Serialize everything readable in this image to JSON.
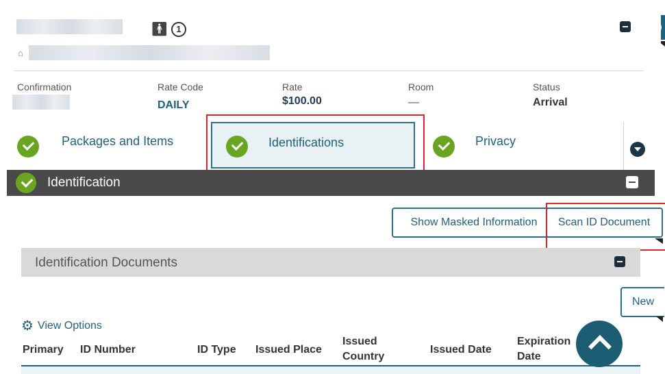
{
  "header": {
    "guest_count": "1",
    "info_icon": "info-circle-icon",
    "home_icon": "home-icon"
  },
  "reservation": {
    "confirmation_label": "Confirmation",
    "rate_code_label": "Rate Code",
    "rate_code_value": "DAILY",
    "rate_label": "Rate",
    "rate_value": "$100.00",
    "room_label": "Room",
    "room_value": "—",
    "status_label": "Status",
    "status_value": "Arrival"
  },
  "tabs": [
    {
      "label": "Packages and Items"
    },
    {
      "label": "Identifications"
    },
    {
      "label": "Privacy"
    }
  ],
  "section": {
    "title": "Identification",
    "show_masked_label": "Show Masked Information",
    "scan_label": "Scan ID Document"
  },
  "documents": {
    "title": "Identification Documents",
    "new_label": "New",
    "view_options_label": "View Options",
    "columns": [
      "Primary",
      "ID Number",
      "ID Type",
      "Issued Place",
      "Issued Country",
      "Issued Date",
      "Expiration Date"
    ]
  },
  "colors": {
    "accent": "#1f5f82",
    "check_green": "#6aa521",
    "highlight_red": "#e0262b",
    "section_bar": "#4a4a4a"
  }
}
